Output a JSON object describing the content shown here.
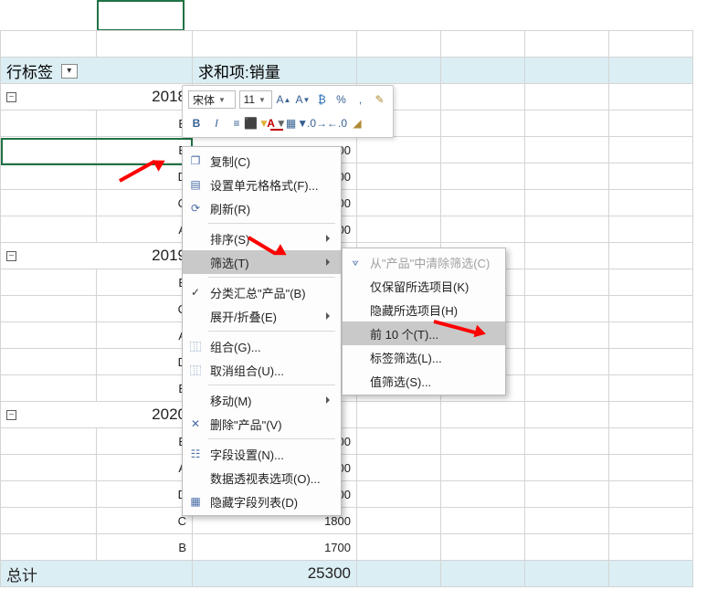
{
  "header": {
    "row_label": "行标签",
    "sum_label": "求和项:销量"
  },
  "footer": {
    "label": "总计",
    "value": "25300"
  },
  "groups": [
    {
      "year": "2018",
      "rows": [
        {
          "key": "E",
          "val": ""
        },
        {
          "key": "B",
          "val": "800"
        },
        {
          "key": "D",
          "val": "00"
        },
        {
          "key": "C",
          "val": "00"
        },
        {
          "key": "A",
          "val": "00"
        }
      ]
    },
    {
      "year": "2019",
      "rows": [
        {
          "key": "E",
          "val": "00"
        },
        {
          "key": "C",
          "val": "00"
        },
        {
          "key": "A",
          "val": "00"
        },
        {
          "key": "D",
          "val": "00"
        },
        {
          "key": "B",
          "val": "00"
        }
      ]
    },
    {
      "year": "2020",
      "rows": [
        {
          "key": "E",
          "val": "00"
        },
        {
          "key": "A",
          "val": "00"
        },
        {
          "key": "D",
          "val": "1900"
        },
        {
          "key": "C",
          "val": "1800"
        },
        {
          "key": "B",
          "val": "1700"
        }
      ]
    }
  ],
  "mini_toolbar": {
    "font_name": "宋体",
    "font_size": "11"
  },
  "context_menu": {
    "copy": "复制(C)",
    "format_cell": "设置单元格格式(F)...",
    "refresh": "刷新(R)",
    "sort": "排序(S)",
    "filter": "筛选(T)",
    "subtotal": "分类汇总\"产品\"(B)",
    "expand": "展开/折叠(E)",
    "group": "组合(G)...",
    "ungroup": "取消组合(U)...",
    "move": "移动(M)",
    "delete": "删除\"产品\"(V)",
    "field_set": "字段设置(N)...",
    "pivot_opt": "数据透视表选项(O)...",
    "hide_list": "隐藏字段列表(D)"
  },
  "filter_submenu": {
    "clear": "从\"产品\"中清除筛选(C)",
    "keep_sel": "仅保留所选项目(K)",
    "hide_sel": "隐藏所选项目(H)",
    "top10": "前 10 个(T)...",
    "label_filter": "标签筛选(L)...",
    "value_filter": "值筛选(S)..."
  }
}
